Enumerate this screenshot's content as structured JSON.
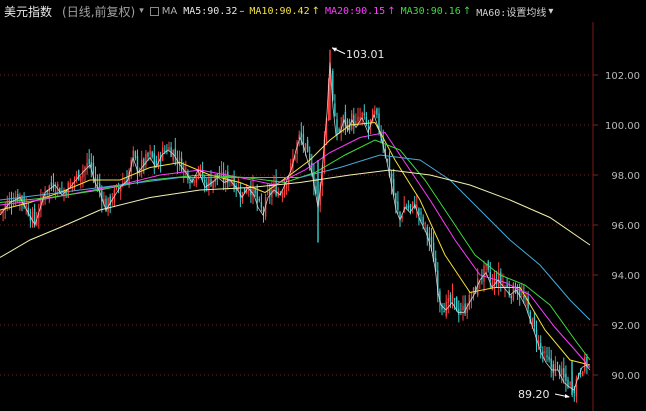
{
  "header": {
    "title": "美元指数",
    "subtitle": "(日线,前复权)",
    "dropdown_icon": "caret-down",
    "ma_label": "MA",
    "ma_items": [
      {
        "text": "MA5:90.32",
        "arrow": "–",
        "color": "#e8e8e8"
      },
      {
        "text": "MA10:90.42",
        "arrow": "↑",
        "color": "#f4e23a"
      },
      {
        "text": "MA20:90.15",
        "arrow": "↑",
        "color": "#ff3cff"
      },
      {
        "text": "MA30:90.16",
        "arrow": "↑",
        "color": "#3cdc3c"
      },
      {
        "text": "MA60:设置均线",
        "arrow": "▾",
        "color": "#d0d0d0"
      }
    ]
  },
  "chart_data": {
    "type": "candlestick",
    "title": "美元指数",
    "subtitle": "(日线,前复权)",
    "y_axis": {
      "ticks": [
        90.0,
        92.0,
        94.0,
        96.0,
        98.0,
        100.0,
        102.0
      ],
      "tick_labels": [
        "90.00",
        "92.00",
        "94.00",
        "96.00",
        "98.00",
        "100.00",
        "102.00"
      ],
      "range": [
        88.8,
        103.5
      ],
      "side": "right",
      "grid": "dotted"
    },
    "annotations": [
      {
        "label": "103.01",
        "value": 103.01,
        "kind": "max"
      },
      {
        "label": "89.20",
        "value": 89.2,
        "kind": "min"
      }
    ],
    "colors": {
      "up": "#ff4040",
      "down": "#3ccfcf",
      "ma5": "#e8e8e8",
      "ma10": "#f4e23a",
      "ma20": "#ff3cff",
      "ma30": "#3cdc3c",
      "ma60": "#48a8d8",
      "ma120": "#f0f0b0"
    },
    "close_path": [
      [
        0,
        96.5
      ],
      [
        10,
        97.0
      ],
      [
        20,
        97.2
      ],
      [
        28,
        96.6
      ],
      [
        35,
        96.1
      ],
      [
        45,
        97.4
      ],
      [
        55,
        97.7
      ],
      [
        62,
        97.3
      ],
      [
        70,
        97.6
      ],
      [
        78,
        98.0
      ],
      [
        85,
        98.3
      ],
      [
        90,
        98.5
      ],
      [
        95,
        97.8
      ],
      [
        100,
        97.4
      ],
      [
        106,
        96.7
      ],
      [
        112,
        97.1
      ],
      [
        120,
        97.6
      ],
      [
        128,
        97.9
      ],
      [
        133,
        98.8
      ],
      [
        138,
        98.2
      ],
      [
        144,
        98.5
      ],
      [
        150,
        98.8
      ],
      [
        156,
        98.4
      ],
      [
        162,
        98.9
      ],
      [
        168,
        99.1
      ],
      [
        174,
        98.9
      ],
      [
        180,
        98.5
      ],
      [
        186,
        98.2
      ],
      [
        192,
        97.8
      ],
      [
        198,
        98.3
      ],
      [
        205,
        97.6
      ],
      [
        212,
        97.8
      ],
      [
        218,
        98.0
      ],
      [
        224,
        97.8
      ],
      [
        230,
        97.9
      ],
      [
        236,
        97.6
      ],
      [
        242,
        97.2
      ],
      [
        248,
        97.6
      ],
      [
        254,
        97.3
      ],
      [
        258,
        96.8
      ],
      [
        263,
        96.5
      ],
      [
        268,
        97.2
      ],
      [
        274,
        97.5
      ],
      [
        280,
        97.3
      ],
      [
        286,
        97.8
      ],
      [
        292,
        98.4
      ],
      [
        296,
        99.1
      ],
      [
        300,
        99.6
      ],
      [
        304,
        99.2
      ],
      [
        308,
        98.6
      ],
      [
        312,
        98.2
      ],
      [
        315,
        97.5
      ],
      [
        318,
        96.8
      ],
      [
        321,
        97.8
      ],
      [
        324,
        99.2
      ],
      [
        327,
        100.6
      ],
      [
        330,
        102.6
      ],
      [
        333,
        100.8
      ],
      [
        336,
        99.7
      ],
      [
        340,
        99.8
      ],
      [
        344,
        100.3
      ],
      [
        348,
        99.9
      ],
      [
        352,
        100.3
      ],
      [
        356,
        100.0
      ],
      [
        362,
        100.4
      ],
      [
        368,
        99.8
      ],
      [
        374,
        100.5
      ],
      [
        380,
        99.8
      ],
      [
        386,
        98.8
      ],
      [
        392,
        97.6
      ],
      [
        396,
        96.7
      ],
      [
        400,
        96.3
      ],
      [
        405,
        96.8
      ],
      [
        410,
        96.6
      ],
      [
        415,
        96.9
      ],
      [
        420,
        96.3
      ],
      [
        426,
        95.8
      ],
      [
        431,
        95.2
      ],
      [
        435,
        94.4
      ],
      [
        438,
        93.4
      ],
      [
        441,
        92.9
      ],
      [
        446,
        92.7
      ],
      [
        452,
        93.0
      ],
      [
        458,
        92.6
      ],
      [
        464,
        92.6
      ],
      [
        468,
        92.9
      ],
      [
        474,
        93.3
      ],
      [
        480,
        93.9
      ],
      [
        486,
        94.2
      ],
      [
        492,
        93.6
      ],
      [
        498,
        93.9
      ],
      [
        504,
        93.6
      ],
      [
        510,
        93.3
      ],
      [
        516,
        93.5
      ],
      [
        521,
        93.2
      ],
      [
        526,
        92.8
      ],
      [
        531,
        92.2
      ],
      [
        536,
        91.6
      ],
      [
        541,
        91.0
      ],
      [
        546,
        90.6
      ],
      [
        552,
        90.3
      ],
      [
        558,
        90.3
      ],
      [
        564,
        89.8
      ],
      [
        570,
        89.6
      ],
      [
        574,
        89.5
      ],
      [
        578,
        90.0
      ],
      [
        582,
        90.4
      ],
      [
        586,
        90.5
      ],
      [
        590,
        90.3
      ]
    ],
    "ma_lines": {
      "ma10": [
        [
          0,
          96.6
        ],
        [
          30,
          96.9
        ],
        [
          60,
          97.3
        ],
        [
          90,
          97.8
        ],
        [
          120,
          97.8
        ],
        [
          150,
          98.3
        ],
        [
          180,
          98.5
        ],
        [
          210,
          98.0
        ],
        [
          240,
          97.7
        ],
        [
          265,
          97.3
        ],
        [
          290,
          98.0
        ],
        [
          310,
          98.6
        ],
        [
          330,
          99.4
        ],
        [
          350,
          100.0
        ],
        [
          375,
          100.1
        ],
        [
          395,
          98.6
        ],
        [
          420,
          97.0
        ],
        [
          445,
          94.8
        ],
        [
          470,
          93.3
        ],
        [
          495,
          93.5
        ],
        [
          520,
          93.5
        ],
        [
          545,
          91.8
        ],
        [
          570,
          90.6
        ],
        [
          590,
          90.4
        ]
      ],
      "ma20": [
        [
          0,
          96.8
        ],
        [
          40,
          97.0
        ],
        [
          80,
          97.3
        ],
        [
          120,
          97.6
        ],
        [
          160,
          98.0
        ],
        [
          200,
          98.2
        ],
        [
          240,
          97.9
        ],
        [
          275,
          97.6
        ],
        [
          305,
          98.2
        ],
        [
          330,
          98.9
        ],
        [
          360,
          99.5
        ],
        [
          385,
          99.7
        ],
        [
          405,
          98.5
        ],
        [
          430,
          97.0
        ],
        [
          455,
          95.4
        ],
        [
          480,
          94.0
        ],
        [
          505,
          93.7
        ],
        [
          530,
          93.2
        ],
        [
          555,
          91.9
        ],
        [
          575,
          91.0
        ],
        [
          590,
          90.3
        ]
      ],
      "ma30": [
        [
          0,
          96.9
        ],
        [
          50,
          97.1
        ],
        [
          100,
          97.4
        ],
        [
          150,
          97.8
        ],
        [
          200,
          98.0
        ],
        [
          245,
          97.9
        ],
        [
          285,
          97.7
        ],
        [
          315,
          98.1
        ],
        [
          345,
          98.8
        ],
        [
          375,
          99.4
        ],
        [
          400,
          99.0
        ],
        [
          425,
          97.8
        ],
        [
          450,
          96.3
        ],
        [
          475,
          94.8
        ],
        [
          500,
          94.0
        ],
        [
          525,
          93.6
        ],
        [
          550,
          92.8
        ],
        [
          575,
          91.4
        ],
        [
          590,
          90.6
        ]
      ],
      "ma60": [
        [
          0,
          97.0
        ],
        [
          60,
          97.3
        ],
        [
          120,
          97.6
        ],
        [
          180,
          97.9
        ],
        [
          240,
          97.9
        ],
        [
          300,
          97.9
        ],
        [
          340,
          98.3
        ],
        [
          380,
          98.8
        ],
        [
          420,
          98.6
        ],
        [
          450,
          97.8
        ],
        [
          480,
          96.6
        ],
        [
          510,
          95.4
        ],
        [
          540,
          94.4
        ],
        [
          570,
          93.0
        ],
        [
          590,
          92.2
        ]
      ],
      "ma120": [
        [
          0,
          94.7
        ],
        [
          30,
          95.4
        ],
        [
          60,
          95.9
        ],
        [
          100,
          96.6
        ],
        [
          150,
          97.1
        ],
        [
          200,
          97.4
        ],
        [
          250,
          97.5
        ],
        [
          300,
          97.7
        ],
        [
          350,
          98.0
        ],
        [
          390,
          98.2
        ],
        [
          430,
          98.0
        ],
        [
          470,
          97.6
        ],
        [
          510,
          97.0
        ],
        [
          550,
          96.3
        ],
        [
          590,
          95.2
        ]
      ]
    }
  }
}
